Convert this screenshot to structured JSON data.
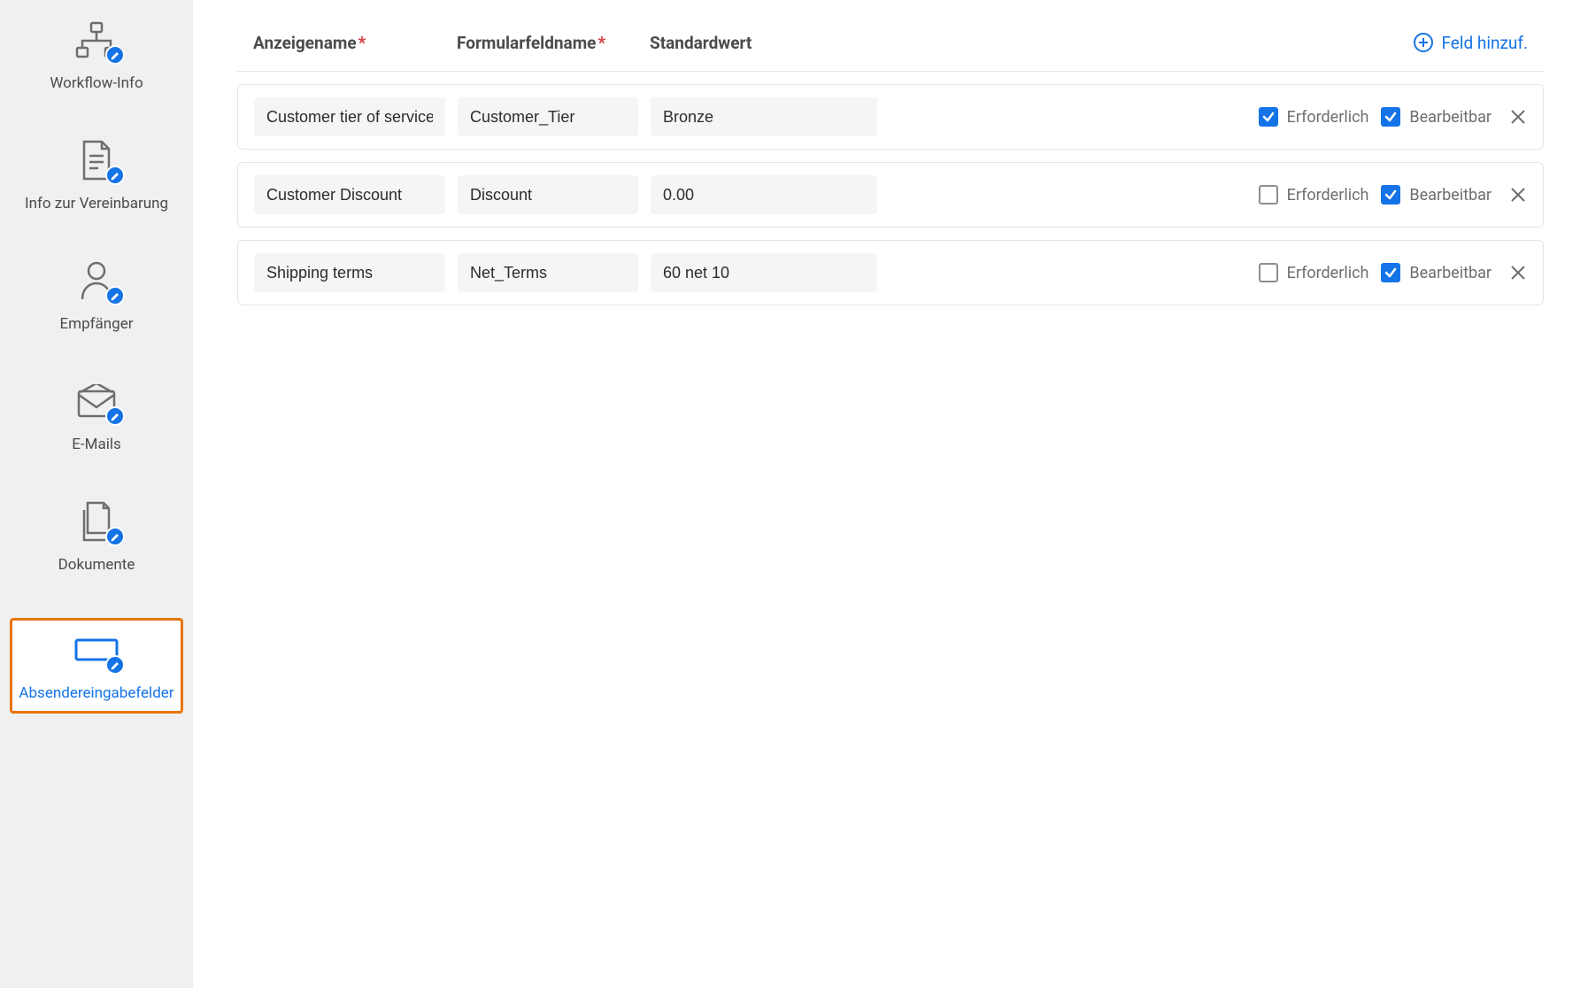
{
  "sidebar": {
    "items": [
      {
        "key": "workflow-info",
        "label": "Workflow-Info"
      },
      {
        "key": "agreement-info",
        "label": "Info zur Vereinbarung"
      },
      {
        "key": "recipients",
        "label": "Empfänger"
      },
      {
        "key": "emails",
        "label": "E-Mails"
      },
      {
        "key": "documents",
        "label": "Dokumente"
      },
      {
        "key": "sender-input-fields",
        "label": "Absendereingabefelder",
        "active": true
      }
    ]
  },
  "header": {
    "display_name": "Anzeigename",
    "form_field_name": "Formularfeldname",
    "default_value": "Standardwert",
    "required_mark": "*",
    "add_field": "Feld hinzuf."
  },
  "labels": {
    "required": "Erforderlich",
    "editable": "Bearbeitbar"
  },
  "rows": [
    {
      "display": "Customer tier of service",
      "form": "Customer_Tier",
      "default": "Bronze",
      "required": true,
      "editable": true
    },
    {
      "display": "Customer Discount",
      "form": "Discount",
      "default": "0.00",
      "required": false,
      "editable": true
    },
    {
      "display": "Shipping terms",
      "form": "Net_Terms",
      "default": "60 net 10",
      "required": false,
      "editable": true
    }
  ]
}
